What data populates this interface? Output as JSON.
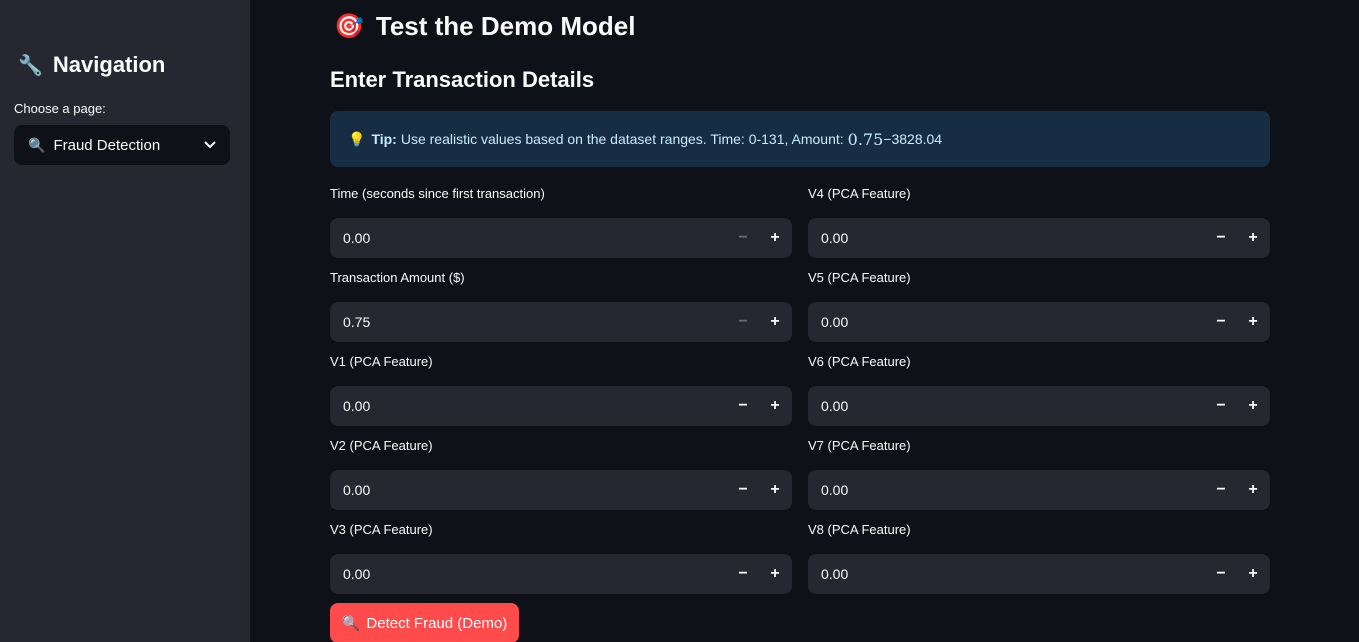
{
  "sidebar": {
    "title": "Navigation",
    "title_icon": "wrench-icon",
    "choose_label": "Choose a page:",
    "select_value": "Fraud Detection",
    "select_icon": "magnifier-icon"
  },
  "main": {
    "title": "Test the Demo Model",
    "title_icon": "target-icon",
    "subheader": "Enter Transaction Details",
    "tip": {
      "label": "Tip:",
      "text": "Use realistic values based on the dataset ranges. Time: 0-131, Amount:",
      "math_value": "0.75",
      "range_tail": "−3828.04"
    },
    "fields": [
      {
        "label": "Time (seconds since first transaction)",
        "value": "0.00",
        "minus_disabled": true
      },
      {
        "label": "Transaction Amount ($)",
        "value": "0.75",
        "minus_disabled": true
      },
      {
        "label": "V1 (PCA Feature)",
        "value": "0.00",
        "minus_disabled": false
      },
      {
        "label": "V2 (PCA Feature)",
        "value": "0.00",
        "minus_disabled": false
      },
      {
        "label": "V3 (PCA Feature)",
        "value": "0.00",
        "minus_disabled": false
      },
      {
        "label": "V4 (PCA Feature)",
        "value": "0.00",
        "minus_disabled": false
      },
      {
        "label": "V5 (PCA Feature)",
        "value": "0.00",
        "minus_disabled": false
      },
      {
        "label": "V6 (PCA Feature)",
        "value": "0.00",
        "minus_disabled": false
      },
      {
        "label": "V7 (PCA Feature)",
        "value": "0.00",
        "minus_disabled": false
      },
      {
        "label": "V8 (PCA Feature)",
        "value": "0.00",
        "minus_disabled": false
      }
    ],
    "stepper": {
      "minus": "−",
      "plus": "+"
    },
    "detect_button": "Detect Fraud (Demo)"
  },
  "colors": {
    "accent": "#ff4b4b",
    "sidebar_bg": "#262730",
    "page_bg": "#0e1117",
    "tip_bg": "#172d43"
  }
}
